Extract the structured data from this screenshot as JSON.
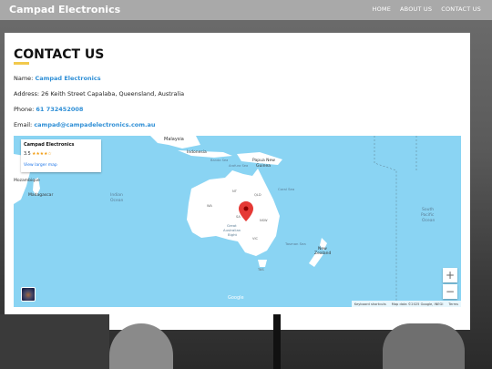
{
  "header": {
    "brand": "Campad Electronics",
    "nav": [
      "HOME",
      "ABOUT US",
      "CONTACT US"
    ]
  },
  "contact": {
    "title": "CONTACT US",
    "name_label": "Name:",
    "name_value": "Campad Electronics",
    "address_label": "Address:",
    "address_value": "26 Keith Street Capalaba, Queensland, Australia",
    "phone_label": "Phone:",
    "phone_value": "61 732452008",
    "email_label": "Email:",
    "email_value": "campad@campadelectronics.com.au"
  },
  "map": {
    "place_name": "Campad Electronics",
    "rating": "3.5",
    "stars": "★★★★☆",
    "view_larger": "View larger map",
    "labels": {
      "malaysia": "Malaysia",
      "indonesia": "Indonesia",
      "papua": "Papua New",
      "guinea": "Guinea",
      "mozambique": "Mozambique",
      "madagascar": "Madagascar",
      "indian1": "Indian",
      "indian2": "Ocean",
      "south": "South",
      "pacific": "Pacific",
      "ocean": "Ocean",
      "nz1": "New",
      "nz2": "Zealand",
      "gab1": "Great",
      "gab2": "Australian",
      "gab3": "Bight",
      "coral": "Coral Sea",
      "tasman": "Tasman Sea",
      "arafura": "Arafura Sea",
      "banda": "Banda Sea",
      "nt": "NT",
      "qld": "QLD",
      "wa": "WA",
      "sa": "SA",
      "nsw": "NSW",
      "vic": "VIC",
      "tas": "TAS"
    },
    "google": "Google",
    "footer": [
      "Keyboard shortcuts",
      "Map data ©2025 Google, INEGI",
      "Terms"
    ],
    "zoom_in": "+",
    "zoom_out": "−"
  },
  "colors": {
    "header_bg": "#a9a9a9",
    "link": "#2f8fd6",
    "accent": "#f2c94c",
    "water": "#8ad4f3",
    "land": "#ffffff",
    "pin": "#e53935"
  }
}
